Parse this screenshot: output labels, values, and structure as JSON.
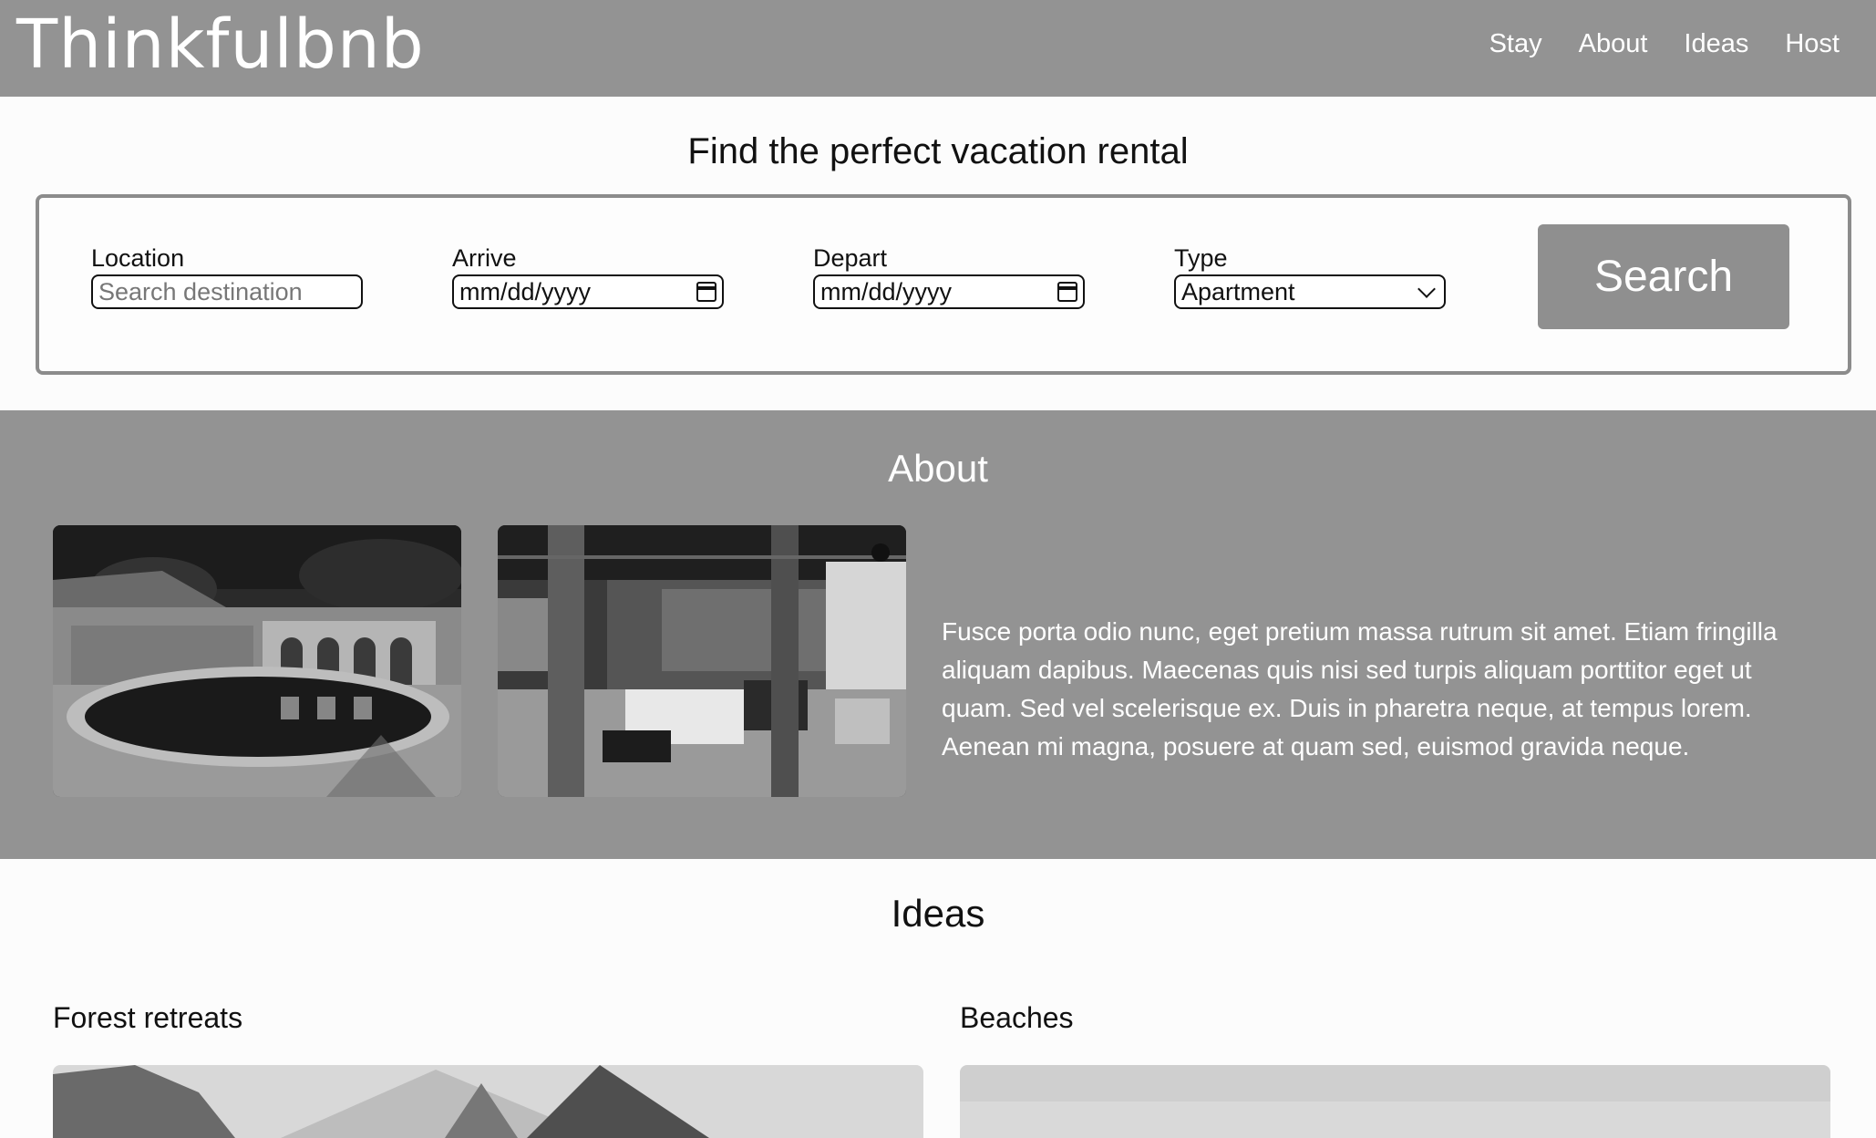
{
  "header": {
    "logo": "Thinkfulbnb",
    "nav": [
      "Stay",
      "About",
      "Ideas",
      "Host"
    ]
  },
  "search": {
    "title": "Find the perfect vacation rental",
    "location": {
      "label": "Location",
      "placeholder": "Search destination"
    },
    "arrive": {
      "label": "Arrive",
      "value": "mm/dd/yyyy"
    },
    "depart": {
      "label": "Depart",
      "value": "mm/dd/yyyy"
    },
    "type": {
      "label": "Type",
      "value": "Apartment"
    },
    "button": "Search"
  },
  "about": {
    "title": "About",
    "text": "Fusce porta odio nunc, eget pretium massa rutrum sit amet. Etiam fringilla aliquam dapibus. Maecenas quis nisi sed turpis aliquam porttitor eget ut quam. Sed vel scelerisque ex. Duis in pharetra neque, at tempus lorem. Aenean mi magna, posuere at quam sed, euismod gravida neque."
  },
  "ideas": {
    "title": "Ideas",
    "items": [
      {
        "label": "Forest retreats"
      },
      {
        "label": "Beaches"
      }
    ]
  },
  "colors": {
    "header_bg": "#939393",
    "about_bg": "#939393",
    "button_bg": "#8f8f8f"
  }
}
